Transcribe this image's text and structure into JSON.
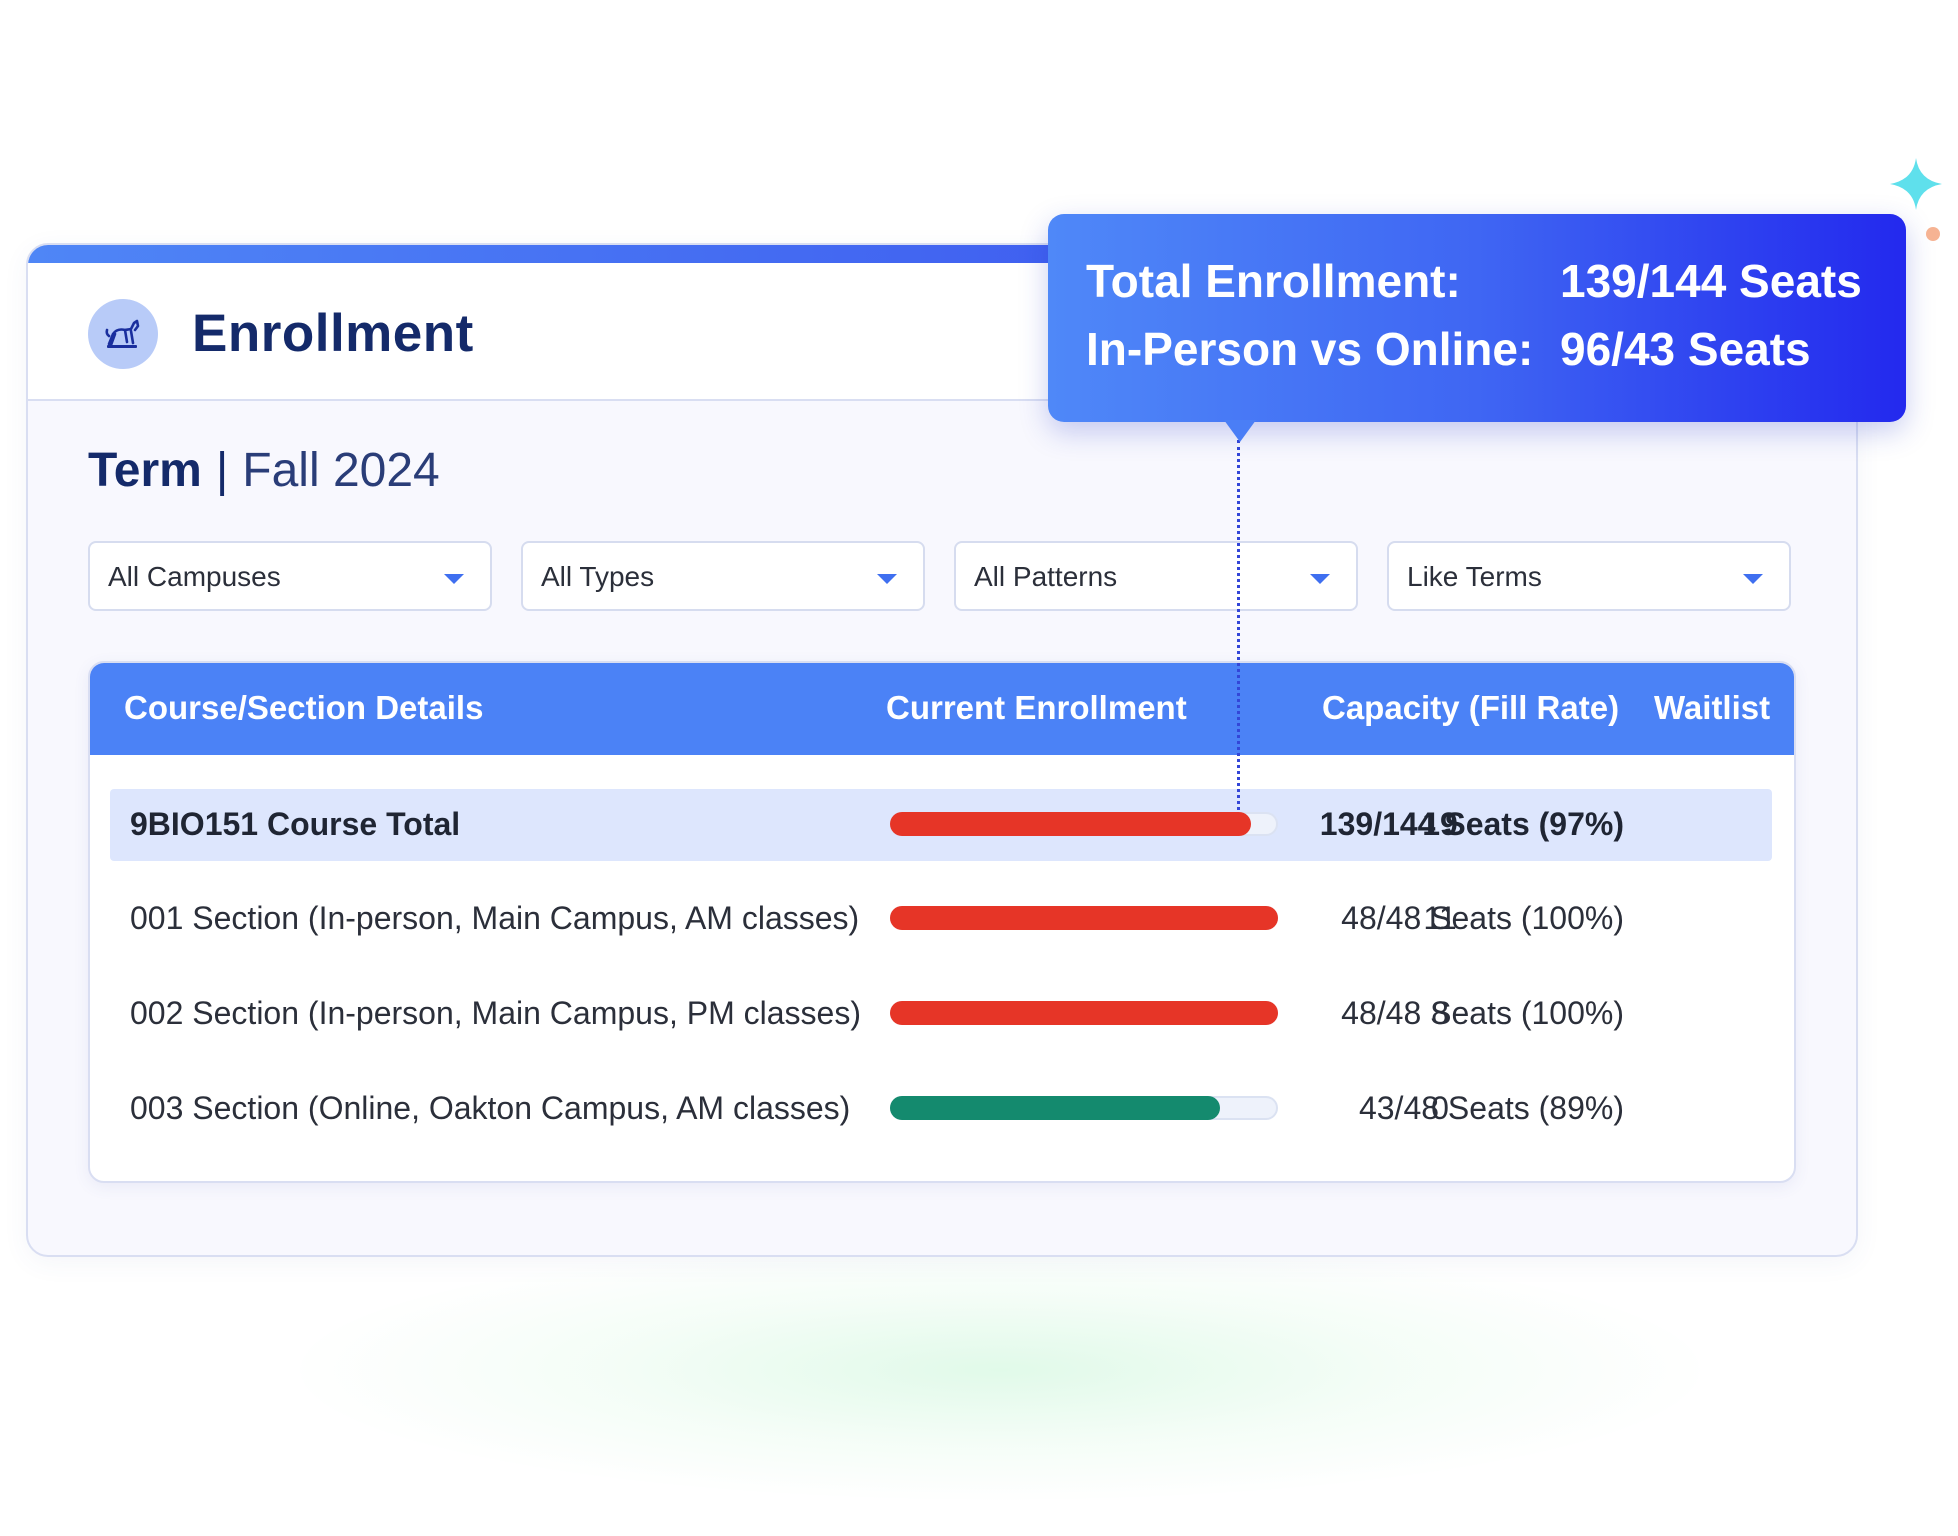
{
  "card": {
    "title": "Enrollment",
    "logo_icon": "greyhound-logo-icon"
  },
  "term": {
    "label": "Term",
    "separator": "|",
    "value": "Fall 2024"
  },
  "filters": [
    {
      "label": "All Campuses"
    },
    {
      "label": "All Types"
    },
    {
      "label": "All Patterns"
    },
    {
      "label": "Like Terms"
    }
  ],
  "table": {
    "headers": {
      "details": "Course/Section Details",
      "enrollment": "Current Enrollment",
      "capacity": "Capacity (Fill Rate)",
      "waitlist": "Waitlist"
    },
    "rows": [
      {
        "name": "9BIO151 Course Total",
        "fill": 0.93,
        "bar_color": "#e63527",
        "capacity": "139/144 Seats (97%)",
        "waitlist": "19"
      },
      {
        "name": "001 Section (In-person, Main Campus, AM classes)",
        "fill": 1.0,
        "bar_color": "#e63527",
        "capacity": "48/48 Seats (100%)",
        "waitlist": "11"
      },
      {
        "name": "002 Section (In-person, Main Campus, PM classes)",
        "fill": 1.0,
        "bar_color": "#e63527",
        "capacity": "48/48 Seats (100%)",
        "waitlist": "8"
      },
      {
        "name": "003 Section (Online, Oakton Campus, AM classes)",
        "fill": 0.85,
        "bar_color": "#148a6e",
        "capacity": "43/48 Seats (89%)",
        "waitlist": "0"
      }
    ]
  },
  "tooltip": {
    "total_label": "Total Enrollment:",
    "total_value": "139/144 Seats",
    "split_label": "In-Person vs Online:",
    "split_value": "96/43 Seats"
  },
  "decor": {
    "sparkle_icon": "sparkle-icon",
    "sparkle_color": "#5fe0ec",
    "dot_color": "#f6b393"
  }
}
